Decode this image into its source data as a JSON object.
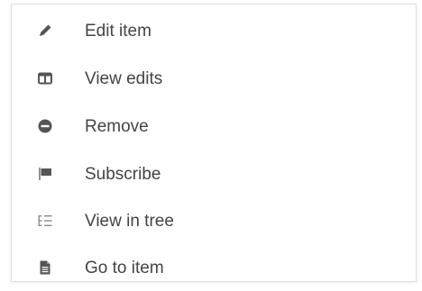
{
  "menu": {
    "items": [
      {
        "label": "Edit item",
        "icon": "pencil-icon"
      },
      {
        "label": "View edits",
        "icon": "columns-icon"
      },
      {
        "label": "Remove",
        "icon": "minus-circle-icon"
      },
      {
        "label": "Subscribe",
        "icon": "flag-icon"
      },
      {
        "label": "View in tree",
        "icon": "tree-list-icon"
      },
      {
        "label": "Go to item",
        "icon": "file-icon"
      }
    ]
  },
  "colors": {
    "text": "#444444",
    "icon": "#555555",
    "icon_light": "#8a8a8a",
    "border": "#e0e0e0"
  }
}
